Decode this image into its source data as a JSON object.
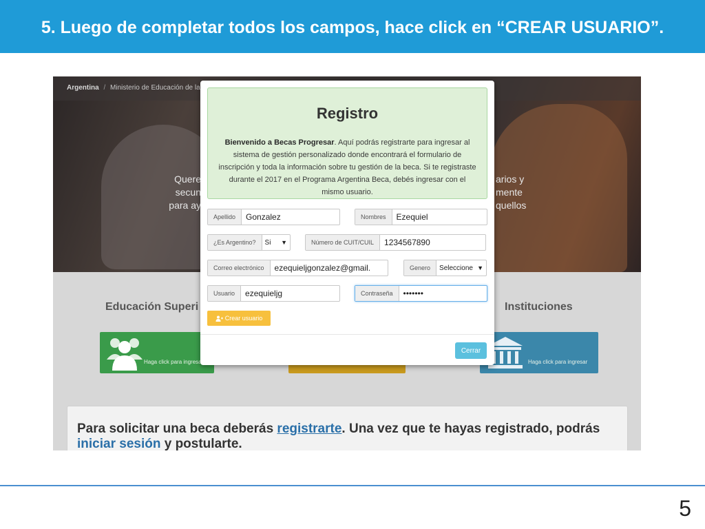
{
  "slide": {
    "title": "5. Luego de completar todos los campos, hace click en  “CREAR USUARIO”.",
    "page_number": "5",
    "header_color": "#1f9bd7"
  },
  "site": {
    "breadcrumb": [
      "Argentina",
      "/",
      "Ministerio de Educación de la"
    ],
    "hero_left_lines": [
      "Quere",
      "secun",
      "para ay"
    ],
    "hero_right_lines": [
      "arios y",
      "mente",
      "quellos"
    ],
    "sections": [
      "Educación Superi",
      "Instituciones"
    ],
    "card_labels": [
      "Haga click para ingresar",
      "Haga click para ingresar"
    ],
    "info": {
      "part1": "Para solicitar una beca deberás ",
      "link1": "registrarte",
      "part2": ". Una vez que te hayas registrado, podrás ",
      "link2": "iniciar sesión",
      "part3": " y postularte."
    }
  },
  "modal": {
    "title": "Registro",
    "welcome_bold": "Bienvenido a Becas Progresar",
    "welcome_rest": ". Aquí podrás registrarte para ingresar al sistema de gestión personalizado donde encontrará el formulario de inscripción y toda la información sobre tu gestión de la beca. Si te registraste durante el 2017 en el Programa Argentina Beca, debés ingresar con el mismo usuario.",
    "fields": {
      "apellido": {
        "label": "Apellido",
        "value": "Gonzalez"
      },
      "nombres": {
        "label": "Nombres",
        "value": "Ezequiel"
      },
      "es_argentino": {
        "label": "¿Es Argentino?",
        "value": "Si"
      },
      "cuit": {
        "label": "Número de CUIT/CUIL",
        "value": "1234567890"
      },
      "email": {
        "label": "Correo electrónico",
        "value": "ezequieljgonzalez@gmail."
      },
      "genero": {
        "label": "Genero",
        "value": "Seleccione"
      },
      "usuario": {
        "label": "Usuario",
        "value": "ezequieljg"
      },
      "contrasena": {
        "label": "Contraseña",
        "value": "•••••••"
      }
    },
    "create_button": "Crear usuario",
    "close_button": "Cerrar",
    "colors": {
      "alert_bg": "#dff0d8",
      "create_btn": "#f7c03d",
      "close_btn": "#5bc0de"
    }
  }
}
